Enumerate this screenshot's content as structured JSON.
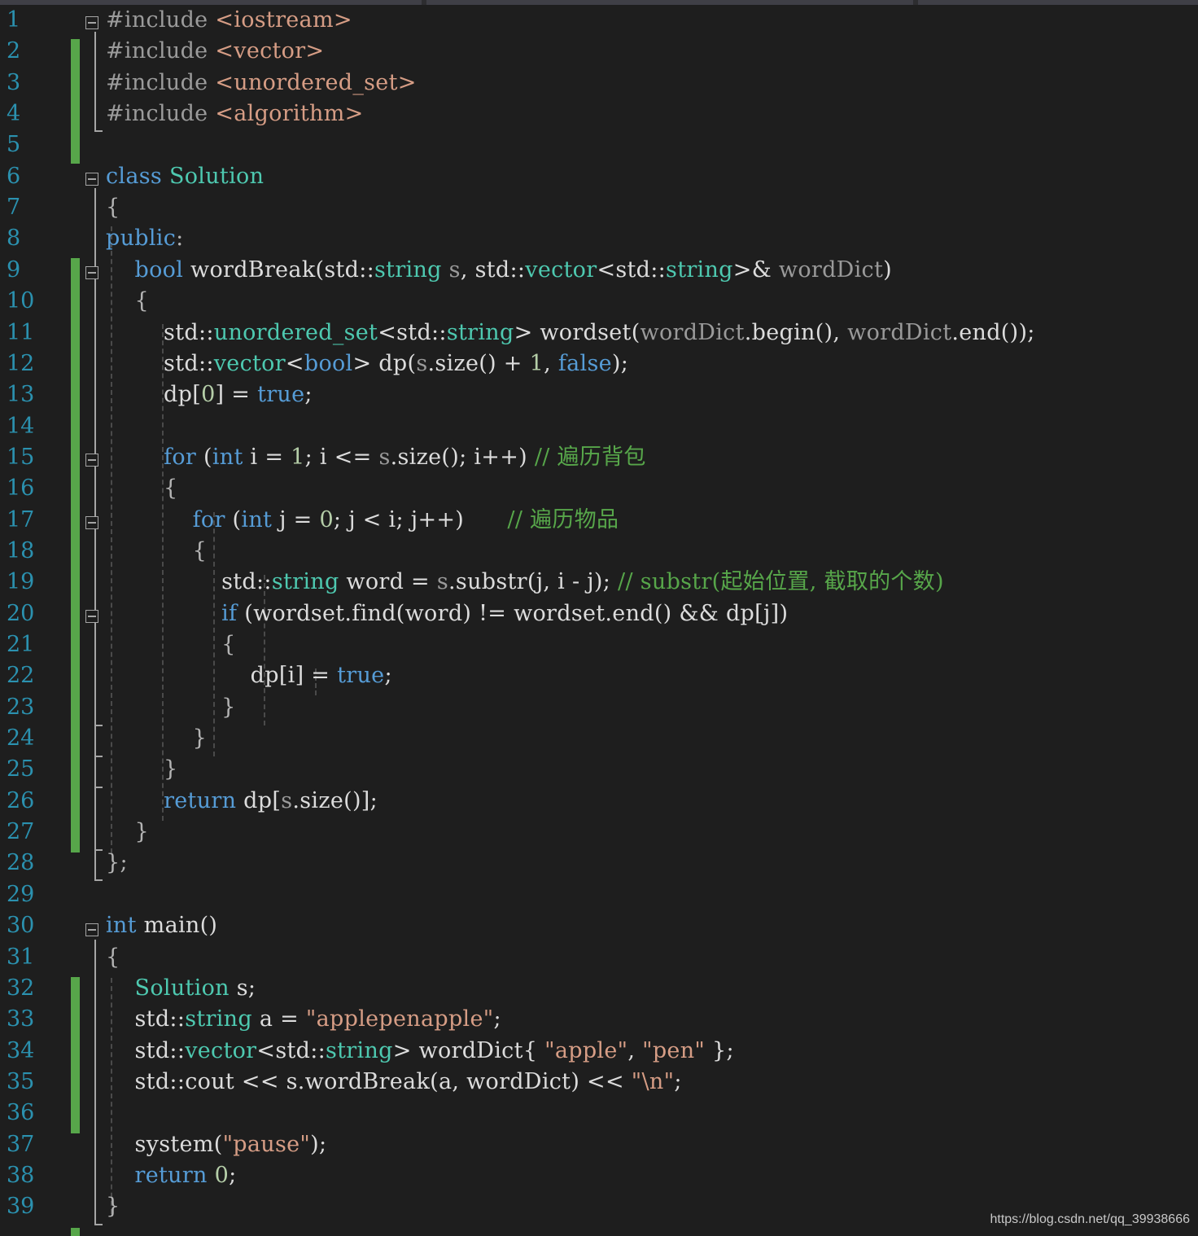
{
  "editor": {
    "lines": [
      {
        "n": "1",
        "tokens": [
          {
            "t": "#include ",
            "c": "pre"
          },
          {
            "t": "<iostream>",
            "c": "inc"
          }
        ]
      },
      {
        "n": "2",
        "tokens": [
          {
            "t": "#include ",
            "c": "pre"
          },
          {
            "t": "<vector>",
            "c": "inc"
          }
        ]
      },
      {
        "n": "3",
        "tokens": [
          {
            "t": "#include ",
            "c": "pre"
          },
          {
            "t": "<unordered_set>",
            "c": "inc"
          }
        ]
      },
      {
        "n": "4",
        "tokens": [
          {
            "t": "#include ",
            "c": "pre"
          },
          {
            "t": "<algorithm>",
            "c": "inc"
          }
        ]
      },
      {
        "n": "5",
        "tokens": []
      },
      {
        "n": "6",
        "tokens": [
          {
            "t": "class ",
            "c": "kw"
          },
          {
            "t": "Solution",
            "c": "ty"
          }
        ]
      },
      {
        "n": "7",
        "tokens": [
          {
            "t": "{",
            "c": "pun"
          }
        ]
      },
      {
        "n": "8",
        "tokens": [
          {
            "t": "public",
            "c": "kw"
          },
          {
            "t": ":",
            "c": "pun"
          }
        ]
      },
      {
        "n": "9",
        "tokens": [
          {
            "t": "    "
          },
          {
            "t": "bool ",
            "c": "kw"
          },
          {
            "t": "wordBreak",
            "c": "fn"
          },
          {
            "t": "(std::",
            "c": "fn"
          },
          {
            "t": "string",
            "c": "ty"
          },
          {
            "t": " s",
            "c": "par"
          },
          {
            "t": ", std::",
            "c": "fn"
          },
          {
            "t": "vector",
            "c": "ty"
          },
          {
            "t": "<std::",
            "c": "fn"
          },
          {
            "t": "string",
            "c": "ty"
          },
          {
            "t": ">& ",
            "c": "fn"
          },
          {
            "t": "wordDict",
            "c": "par"
          },
          {
            "t": ")",
            "c": "fn"
          }
        ]
      },
      {
        "n": "10",
        "tokens": [
          {
            "t": "    {",
            "c": "pun"
          }
        ]
      },
      {
        "n": "11",
        "tokens": [
          {
            "t": "        std::",
            "c": "fn"
          },
          {
            "t": "unordered_set",
            "c": "ty"
          },
          {
            "t": "<std::",
            "c": "fn"
          },
          {
            "t": "string",
            "c": "ty"
          },
          {
            "t": "> wordset(",
            "c": "fn"
          },
          {
            "t": "wordDict",
            "c": "par"
          },
          {
            "t": ".begin(), ",
            "c": "fn"
          },
          {
            "t": "wordDict",
            "c": "par"
          },
          {
            "t": ".end());",
            "c": "fn"
          }
        ]
      },
      {
        "n": "12",
        "tokens": [
          {
            "t": "        std::",
            "c": "fn"
          },
          {
            "t": "vector",
            "c": "ty"
          },
          {
            "t": "<",
            "c": "fn"
          },
          {
            "t": "bool",
            "c": "kw"
          },
          {
            "t": "> dp(",
            "c": "fn"
          },
          {
            "t": "s",
            "c": "par"
          },
          {
            "t": ".size() + ",
            "c": "fn"
          },
          {
            "t": "1",
            "c": "num"
          },
          {
            "t": ", ",
            "c": "fn"
          },
          {
            "t": "false",
            "c": "kw"
          },
          {
            "t": ");",
            "c": "fn"
          }
        ]
      },
      {
        "n": "13",
        "tokens": [
          {
            "t": "        dp[",
            "c": "fn"
          },
          {
            "t": "0",
            "c": "num"
          },
          {
            "t": "] = ",
            "c": "fn"
          },
          {
            "t": "true",
            "c": "kw"
          },
          {
            "t": ";",
            "c": "fn"
          }
        ]
      },
      {
        "n": "14",
        "tokens": []
      },
      {
        "n": "15",
        "tokens": [
          {
            "t": "        "
          },
          {
            "t": "for ",
            "c": "kw"
          },
          {
            "t": "(",
            "c": "fn"
          },
          {
            "t": "int ",
            "c": "kw"
          },
          {
            "t": "i = ",
            "c": "fn"
          },
          {
            "t": "1",
            "c": "num"
          },
          {
            "t": "; i <= ",
            "c": "fn"
          },
          {
            "t": "s",
            "c": "par"
          },
          {
            "t": ".size(); i++) ",
            "c": "fn"
          },
          {
            "t": "// 遍历背包",
            "c": "cm"
          }
        ]
      },
      {
        "n": "16",
        "tokens": [
          {
            "t": "        {",
            "c": "pun"
          }
        ]
      },
      {
        "n": "17",
        "tokens": [
          {
            "t": "            "
          },
          {
            "t": "for ",
            "c": "kw"
          },
          {
            "t": "(",
            "c": "fn"
          },
          {
            "t": "int ",
            "c": "kw"
          },
          {
            "t": "j = ",
            "c": "fn"
          },
          {
            "t": "0",
            "c": "num"
          },
          {
            "t": "; j < i; j++)      ",
            "c": "fn"
          },
          {
            "t": "// 遍历物品",
            "c": "cm"
          }
        ]
      },
      {
        "n": "18",
        "tokens": [
          {
            "t": "            {",
            "c": "pun"
          }
        ]
      },
      {
        "n": "19",
        "tokens": [
          {
            "t": "                std::",
            "c": "fn"
          },
          {
            "t": "string ",
            "c": "ty"
          },
          {
            "t": "word = ",
            "c": "fn"
          },
          {
            "t": "s",
            "c": "par"
          },
          {
            "t": ".substr(j, i - j); ",
            "c": "fn"
          },
          {
            "t": "// substr(起始位置, 截取的个数)",
            "c": "cm"
          }
        ]
      },
      {
        "n": "20",
        "tokens": [
          {
            "t": "                "
          },
          {
            "t": "if ",
            "c": "kw"
          },
          {
            "t": "(wordset.find(word) != wordset.end() && dp[j])",
            "c": "fn"
          }
        ]
      },
      {
        "n": "21",
        "tokens": [
          {
            "t": "                {",
            "c": "pun"
          }
        ]
      },
      {
        "n": "22",
        "tokens": [
          {
            "t": "                    dp[i] = ",
            "c": "fn"
          },
          {
            "t": "true",
            "c": "kw"
          },
          {
            "t": ";",
            "c": "fn"
          }
        ]
      },
      {
        "n": "23",
        "tokens": [
          {
            "t": "                }",
            "c": "pun"
          }
        ]
      },
      {
        "n": "24",
        "tokens": [
          {
            "t": "            }",
            "c": "pun"
          }
        ]
      },
      {
        "n": "25",
        "tokens": [
          {
            "t": "        }",
            "c": "pun"
          }
        ]
      },
      {
        "n": "26",
        "tokens": [
          {
            "t": "        "
          },
          {
            "t": "return ",
            "c": "kw"
          },
          {
            "t": "dp[",
            "c": "fn"
          },
          {
            "t": "s",
            "c": "par"
          },
          {
            "t": ".size()];",
            "c": "fn"
          }
        ]
      },
      {
        "n": "27",
        "tokens": [
          {
            "t": "    }",
            "c": "pun"
          }
        ]
      },
      {
        "n": "28",
        "tokens": [
          {
            "t": "};",
            "c": "pun"
          }
        ]
      },
      {
        "n": "29",
        "tokens": []
      },
      {
        "n": "30",
        "tokens": [
          {
            "t": "int ",
            "c": "kw"
          },
          {
            "t": "main()",
            "c": "fn"
          }
        ]
      },
      {
        "n": "31",
        "tokens": [
          {
            "t": "{",
            "c": "pun"
          }
        ]
      },
      {
        "n": "32",
        "tokens": [
          {
            "t": "    "
          },
          {
            "t": "Solution ",
            "c": "ty"
          },
          {
            "t": "s;",
            "c": "fn"
          }
        ]
      },
      {
        "n": "33",
        "tokens": [
          {
            "t": "    std::",
            "c": "fn"
          },
          {
            "t": "string ",
            "c": "ty"
          },
          {
            "t": "a = ",
            "c": "fn"
          },
          {
            "t": "\"applepenapple\"",
            "c": "str"
          },
          {
            "t": ";",
            "c": "fn"
          }
        ]
      },
      {
        "n": "34",
        "tokens": [
          {
            "t": "    std::",
            "c": "fn"
          },
          {
            "t": "vector",
            "c": "ty"
          },
          {
            "t": "<std::",
            "c": "fn"
          },
          {
            "t": "string",
            "c": "ty"
          },
          {
            "t": "> wordDict{ ",
            "c": "fn"
          },
          {
            "t": "\"apple\"",
            "c": "str"
          },
          {
            "t": ", ",
            "c": "fn"
          },
          {
            "t": "\"pen\"",
            "c": "str"
          },
          {
            "t": " };",
            "c": "fn"
          }
        ]
      },
      {
        "n": "35",
        "tokens": [
          {
            "t": "    std::cout << s.wordBreak(a, wordDict) << ",
            "c": "fn"
          },
          {
            "t": "\"\\n\"",
            "c": "str"
          },
          {
            "t": ";",
            "c": "fn"
          }
        ]
      },
      {
        "n": "36",
        "tokens": []
      },
      {
        "n": "37",
        "tokens": [
          {
            "t": "    system(",
            "c": "fn"
          },
          {
            "t": "\"pause\"",
            "c": "str"
          },
          {
            "t": ");",
            "c": "fn"
          }
        ]
      },
      {
        "n": "38",
        "tokens": [
          {
            "t": "    "
          },
          {
            "t": "return ",
            "c": "kw"
          },
          {
            "t": "0",
            "c": "num"
          },
          {
            "t": ";",
            "c": "fn"
          }
        ]
      },
      {
        "n": "39",
        "tokens": [
          {
            "t": "}",
            "c": "pun"
          }
        ]
      }
    ]
  },
  "watermark": "https://blog.csdn.net/qq_39938666",
  "colors": {
    "background": "#1e1e1e",
    "line_number": "#2b91af",
    "keyword": "#569cd6",
    "type": "#4ec9b0",
    "string": "#d69d85",
    "comment": "#57a64a",
    "change_marker": "#57a64a"
  }
}
